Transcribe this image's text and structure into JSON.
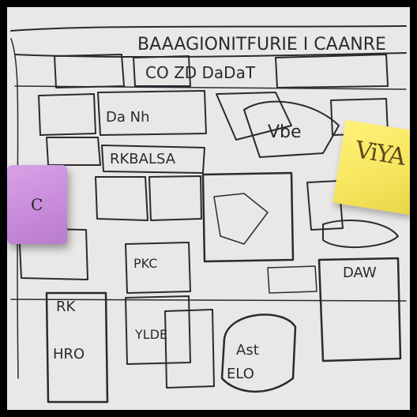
{
  "photo": {
    "scrawls": {
      "heading": "BAAAGIONITFURIE I CAANRE",
      "top_row": "CO    ZD    DaDaT",
      "mid_left": "Da   Nh",
      "mid_center": "RKBALSA",
      "mid_right": "Vbe",
      "left_box": "PKC",
      "right_box": "DAW",
      "lower_center": "Ast",
      "bottom_left_1": "RK",
      "bottom_left_2": "HRO",
      "bottom_center": "YLDE",
      "bottom_pot": "ELO"
    },
    "props": {
      "pink_cube_glyph": "C",
      "sticky_note_scribble": "ViYA"
    },
    "colors": {
      "paper": "#eae8e6",
      "ink": "#2a2a30",
      "pink_cube": "#c98bdb",
      "sticky_note": "#f5e45c",
      "frame": "#000000"
    }
  }
}
